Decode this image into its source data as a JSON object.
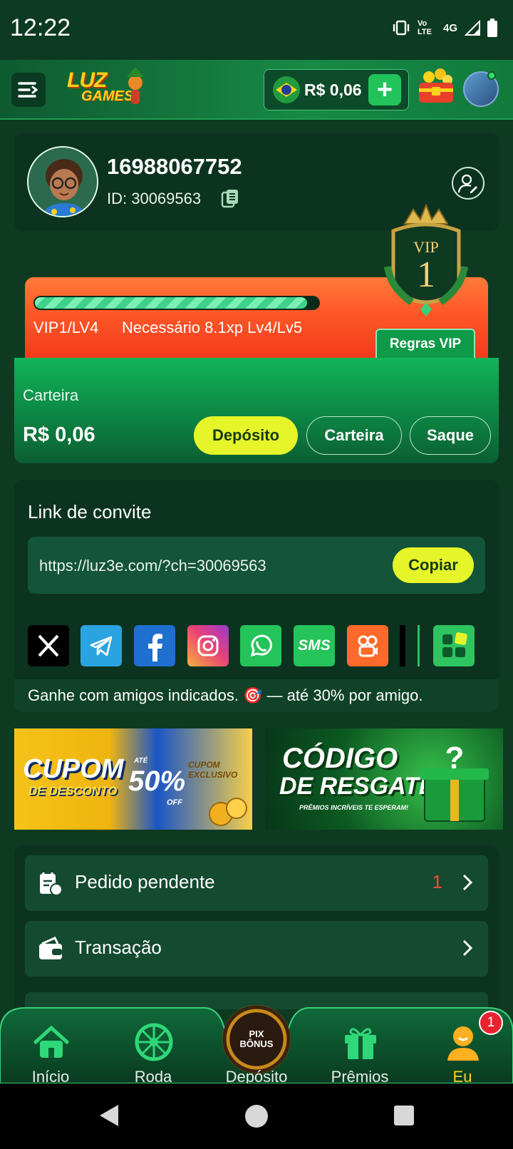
{
  "status_bar": {
    "time": "12:22",
    "network": "4G",
    "lte": "Vo LTE"
  },
  "header": {
    "logo_top": "LUZ",
    "logo_bottom": "GAMES",
    "balance": "R$ 0,06",
    "plus": "+",
    "accent": "#22c35a"
  },
  "profile": {
    "phone": "16988067752",
    "id_label": "ID: 30069563"
  },
  "vip": {
    "progress_fraction": 0.96,
    "level": "VIP1/LV4",
    "requirement": "Necessário 8.1xp Lv4/Lv5",
    "rules_button": "Regras VIP",
    "badge_text": "VIP",
    "badge_number": "1"
  },
  "wallet": {
    "label": "Carteira",
    "amount": "R$ 0,06",
    "deposit_button": "Depósito",
    "wallet_button": "Carteira",
    "withdraw_button": "Saque"
  },
  "invite": {
    "title": "Link de convite",
    "link": "https://luz3e.com/?ch=30069563",
    "copy_button": "Copiar",
    "share": [
      {
        "name": "x-icon",
        "glyph": "X",
        "bg": "#000000"
      },
      {
        "name": "telegram-icon",
        "glyph": "",
        "bg": "#2aa3e0"
      },
      {
        "name": "facebook-icon",
        "glyph": "f",
        "bg": "#1f6fd1"
      },
      {
        "name": "instagram-icon",
        "glyph": "",
        "bg": "#e8407a"
      },
      {
        "name": "whatsapp-icon",
        "glyph": "",
        "bg": "#25c45a"
      },
      {
        "name": "sms-icon",
        "glyph": "SMS",
        "bg": "#25c45a"
      },
      {
        "name": "kwai-icon",
        "glyph": "",
        "bg": "#ff6a2a"
      }
    ],
    "note": "Ganhe com amigos indicados. 🎯 — até 30% por amigo."
  },
  "banners": {
    "left_title": "CUPOM",
    "left_subtitle": "DE DESCONTO",
    "left_percent": "50%",
    "left_off": "OFF",
    "left_ate": "ATÉ",
    "left_ticket": "CUPOM EXCLUSIVO",
    "right_title": "CÓDIGO",
    "right_subtitle": "DE RESGATE",
    "right_tagline": "PRÊMIOS INCRÍVEIS TE ESPERAM!"
  },
  "menu": [
    {
      "label": "Pedido pendente",
      "count": "1"
    },
    {
      "label": "Transação",
      "count": ""
    }
  ],
  "bottom_nav": {
    "items": [
      "Início",
      "Roda",
      "Depósito",
      "Prêmios",
      "Eu"
    ],
    "center_text": "PIX BÔNUS",
    "badge": "1",
    "active_color": "#ffd21a"
  }
}
